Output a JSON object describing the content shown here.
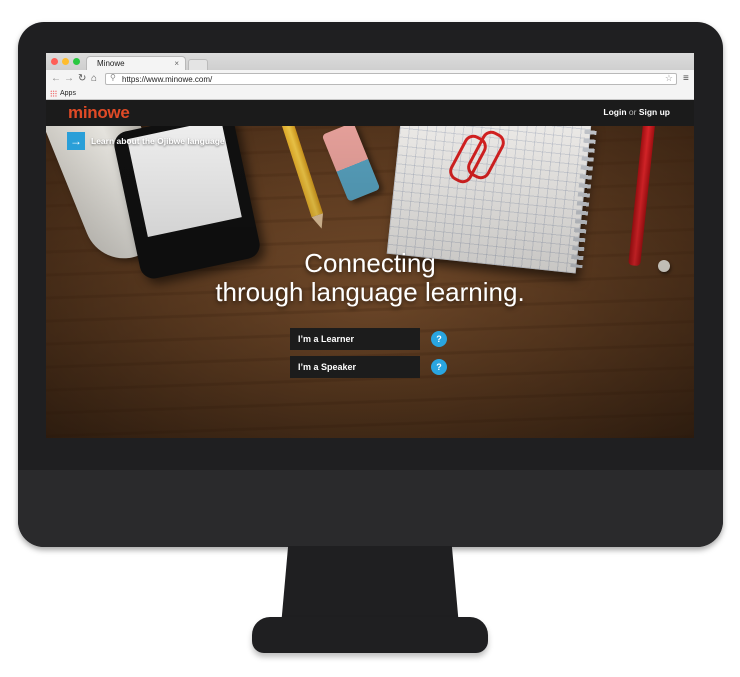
{
  "browser": {
    "tab_title": "Minowe",
    "tab_close": "×",
    "url": "https://www.minowe.com/",
    "bookmarks": {
      "apps_label": "Apps"
    },
    "traffic_lights": [
      "#ff5f57",
      "#ffbd2e",
      "#28c840"
    ]
  },
  "site": {
    "logo": "minowe",
    "logo_color": "#e04a26",
    "auth": {
      "login": "Login",
      "or": "or",
      "signup": "Sign up"
    },
    "learn_link": "Learn about the Ojibwe language",
    "headline_line1": "Connecting",
    "headline_line2": "through language learning.",
    "buttons": {
      "learner": "I’m a Learner",
      "speaker": "I’m a Speaker",
      "help": "?"
    },
    "accent": "#2aa5e0"
  }
}
